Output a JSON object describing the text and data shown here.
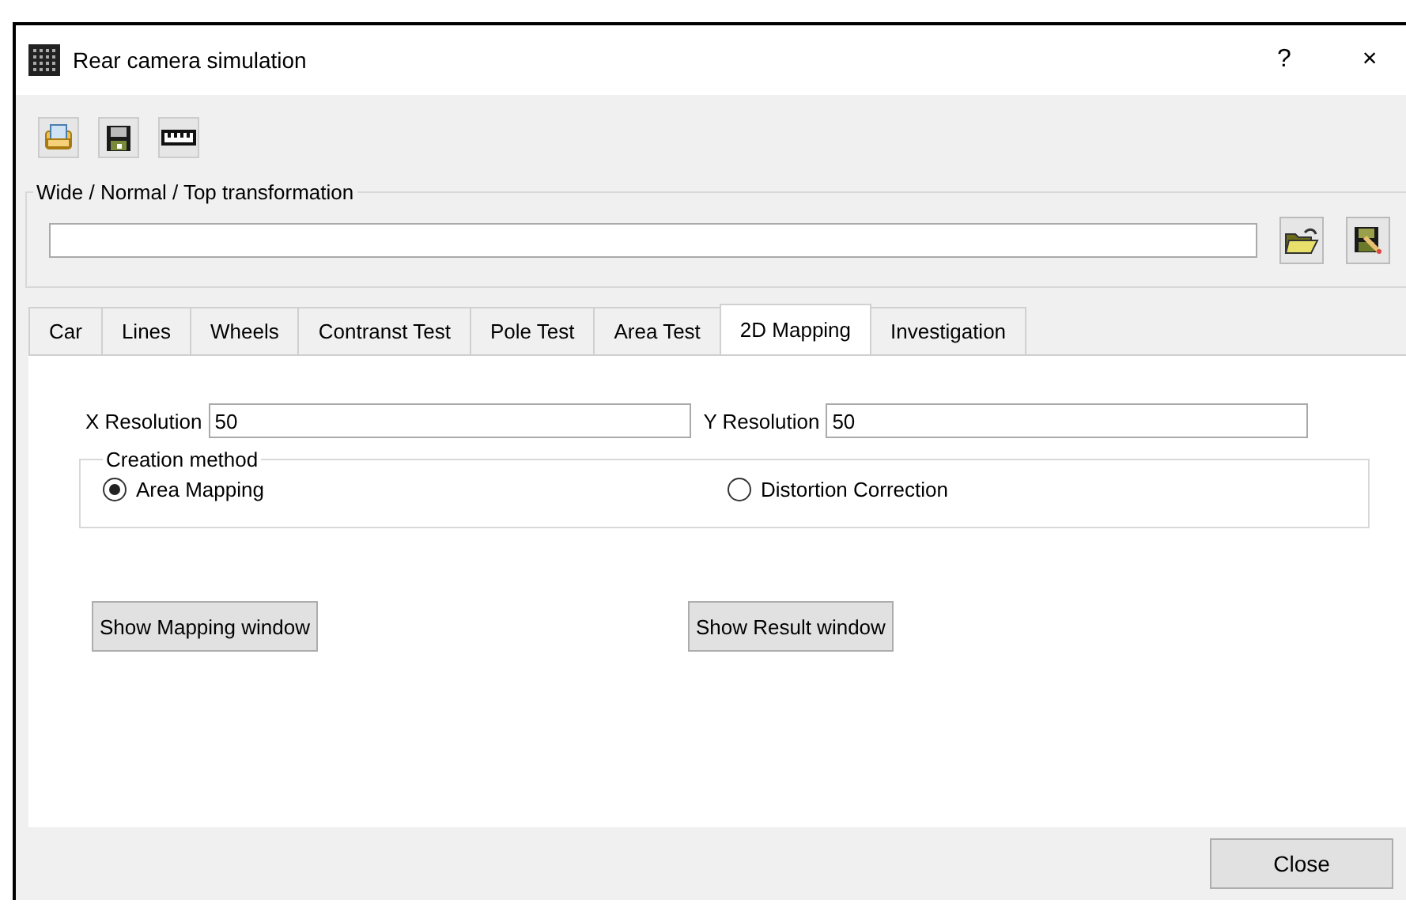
{
  "window": {
    "title": "Rear camera simulation",
    "help": "?",
    "close": "×"
  },
  "toolbar": {
    "buttons": [
      {
        "kind": "print"
      },
      {
        "kind": "save"
      },
      {
        "kind": "ruler"
      }
    ]
  },
  "transformation": {
    "legend": "Wide / Normal / Top transformation",
    "buttons": [
      {
        "kind": "open"
      },
      {
        "kind": "save-edit"
      }
    ]
  },
  "tabs": [
    {
      "label": "Car",
      "selected": false
    },
    {
      "label": "Lines",
      "selected": false
    },
    {
      "label": "Wheels",
      "selected": false
    },
    {
      "label": "Contranst Test",
      "selected": false
    },
    {
      "label": "Pole Test",
      "selected": false
    },
    {
      "label": "Area Test",
      "selected": false
    },
    {
      "label": "2D Mapping",
      "selected": true
    },
    {
      "label": "Investigation",
      "selected": false
    }
  ],
  "mapping": {
    "x_label": "X Resolution",
    "x_value": "50",
    "y_label": "Y Resolution",
    "y_value": "50",
    "creation_method": {
      "legend": "Creation method",
      "options": [
        {
          "label": "Area Mapping",
          "selected": true
        },
        {
          "label": "Distortion Correction",
          "selected": false
        }
      ]
    },
    "buttons": [
      "Show Mapping window",
      "Show Result window"
    ]
  },
  "footer": {
    "close": "Close"
  }
}
